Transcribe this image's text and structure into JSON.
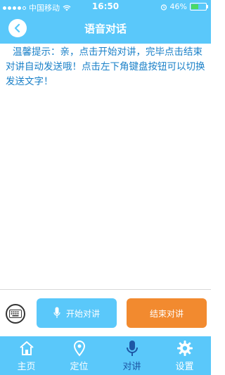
{
  "status_bar": {
    "carrier": "中国移动",
    "time": "16:50",
    "battery_percent": "46%",
    "battery_level": 0.46
  },
  "header": {
    "title": "语音对话"
  },
  "tip": {
    "text": "温馨提示：亲，点击开始对讲，完毕点击结束对讲自动发送哦！点击左下角键盘按钮可以切换发送文字！"
  },
  "controls": {
    "start_label": "开始对讲",
    "stop_label": "结束对讲"
  },
  "tabbar": {
    "items": [
      {
        "label": "主页",
        "icon": "home-icon"
      },
      {
        "label": "定位",
        "icon": "location-pin-icon"
      },
      {
        "label": "对讲",
        "icon": "microphone-icon",
        "active": true
      },
      {
        "label": "设置",
        "icon": "gear-icon"
      }
    ]
  },
  "colors": {
    "accent": "#5ac8fa",
    "stop_button": "#f28a2f",
    "active_tab": "#1d57a5",
    "tip_text": "#1a80c8"
  }
}
